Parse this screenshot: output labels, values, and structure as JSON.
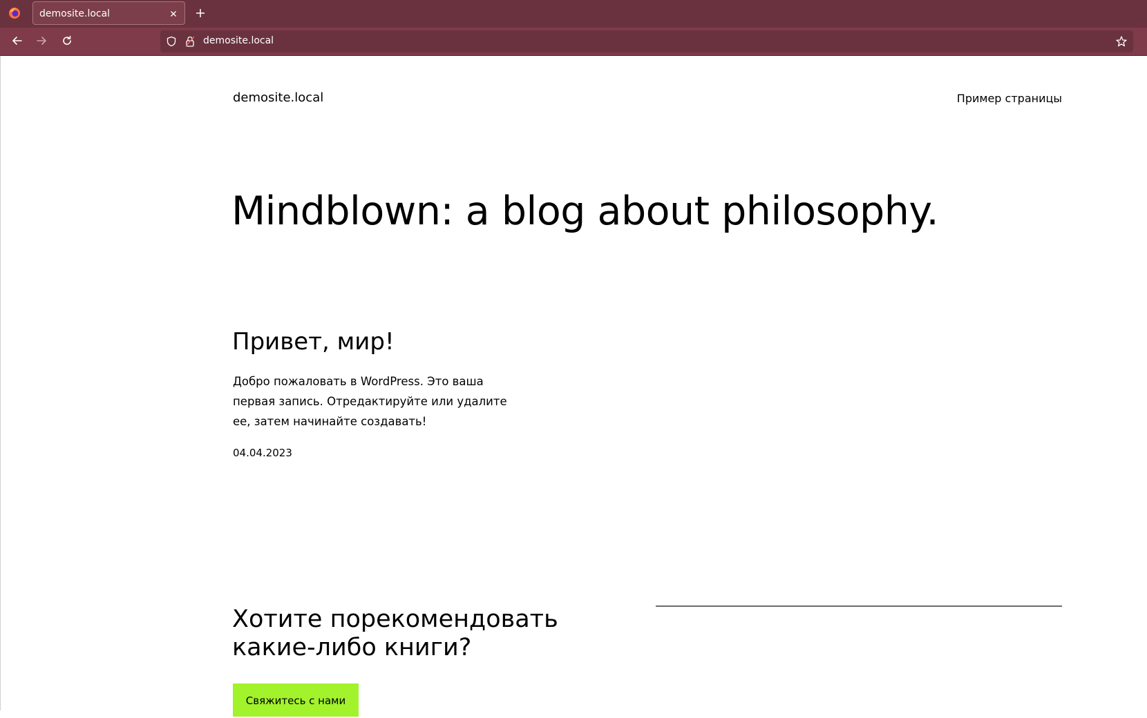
{
  "browser": {
    "tab_title": "demosite.local",
    "url": "demosite.local",
    "colors": {
      "tabbar": "#6a323f",
      "navbar": "#7f3b4a"
    }
  },
  "icons": {
    "browser_logo": "firefox-icon",
    "tab_close": "close-icon",
    "new_tab": "plus-icon",
    "back": "arrow-left-icon",
    "forward": "arrow-right-icon",
    "reload": "reload-icon",
    "tracking": "shield-icon",
    "lock": "lock-icon",
    "bookmark": "star-icon"
  },
  "site": {
    "title": "demosite.local",
    "nav_link": "Пример страницы"
  },
  "hero": {
    "title": "Mindblown: a blog about philosophy."
  },
  "post": {
    "title": "Привет, мир!",
    "excerpt": "Добро пожаловать в WordPress. Это ваша первая запись. Отредактируйте или удалите ее, затем начинайте создавать!",
    "date": "04.04.2023"
  },
  "cta": {
    "heading": "Хотите порекомендовать какие-либо книги?",
    "button_label": "Свяжитесь с нами",
    "button_color": "#a2f22c"
  }
}
